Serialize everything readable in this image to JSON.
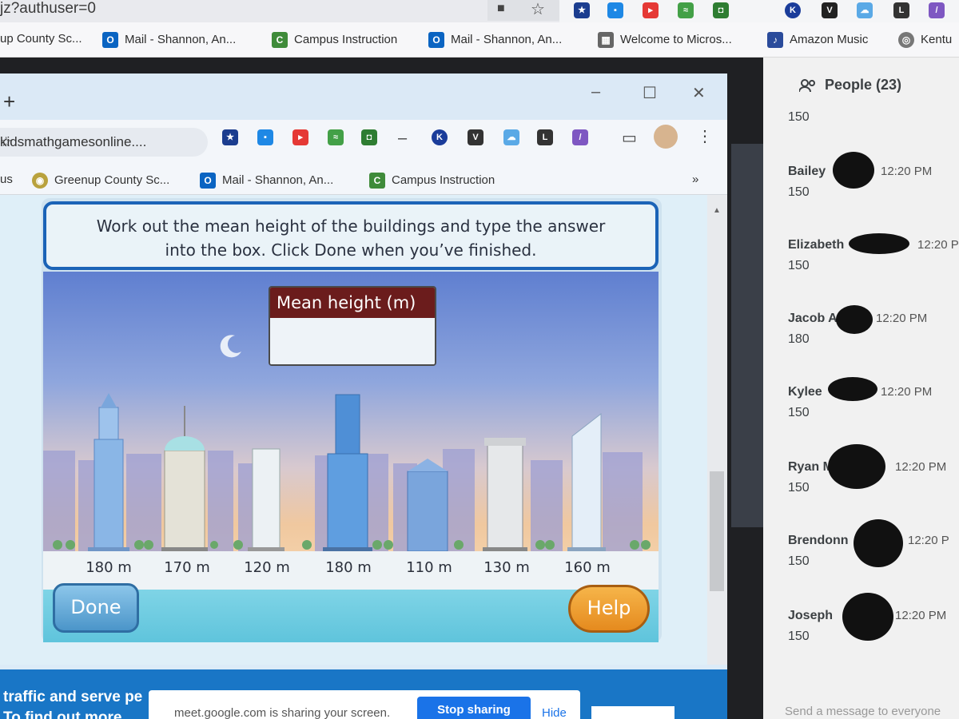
{
  "outer_browser": {
    "url_fragment": "jz?authuser=0",
    "bookmarks": [
      "up County Sc...",
      "Mail - Shannon, An...",
      "Campus Instruction",
      "Mail - Shannon, An...",
      "Welcome to Micros...",
      "Amazon Music",
      "Kentu"
    ]
  },
  "inner_browser": {
    "url": "kidsmathgamesonline....",
    "bookmarks": [
      "us",
      "Greenup County Sc...",
      "Mail - Shannon, An...",
      "Campus Instruction"
    ],
    "overflow": "»"
  },
  "game": {
    "instruction_line1": "Work out the mean height of the buildings and type the answer",
    "instruction_line2": "into the box. Click Done when you’ve finished.",
    "input_label": "Mean height (m)",
    "input_value": "",
    "buildings": [
      {
        "height_label": "180 m"
      },
      {
        "height_label": "170 m"
      },
      {
        "height_label": "120 m"
      },
      {
        "height_label": "180 m"
      },
      {
        "height_label": "110 m"
      },
      {
        "height_label": "130 m"
      },
      {
        "height_label": "160 m"
      }
    ],
    "done_label": "Done",
    "help_label": "Help"
  },
  "page_footer": {
    "line1": "traffic and serve pe",
    "line2": "To find out more"
  },
  "screen_share": {
    "message": "meet.google.com is sharing your screen.",
    "stop_label": "Stop sharing",
    "hide_label": "Hide"
  },
  "people_panel": {
    "title": "People (23)",
    "top_partial_value": "150",
    "messages": [
      {
        "name": "Bailey",
        "time": "12:20 PM",
        "value": "150"
      },
      {
        "name": "Elizabeth",
        "time": "12:20 P",
        "value": "150"
      },
      {
        "name": "Jacob A",
        "time": "12:20 PM",
        "value": "180"
      },
      {
        "name": "Kylee",
        "time": "12:20 PM",
        "value": "150"
      },
      {
        "name": "Ryan M",
        "time": "12:20 PM",
        "value": "150"
      },
      {
        "name": "Brendonn",
        "time": "12:20 P",
        "value": "150"
      },
      {
        "name": "Joseph",
        "time": "12:20 PM",
        "value": "150"
      }
    ],
    "send_placeholder": "Send a message to everyone"
  }
}
